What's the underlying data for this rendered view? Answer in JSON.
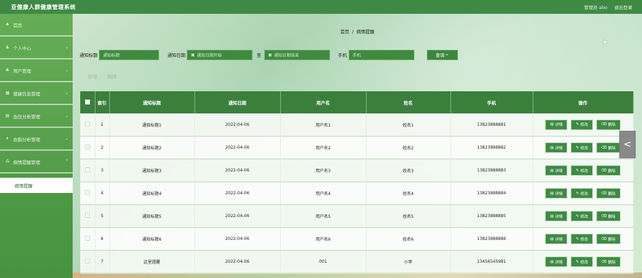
{
  "app": {
    "title": "亚健康人群健康管理系统"
  },
  "top": {
    "user": "管理员 abo",
    "logout": "退出登录"
  },
  "sidebar": {
    "items": [
      {
        "icon": "home-icon",
        "glyph": "♠",
        "label": "首页"
      },
      {
        "icon": "user-icon",
        "glyph": "♟",
        "label": "个人中心",
        "chev": "⌄"
      },
      {
        "icon": "users-icon",
        "glyph": "♣",
        "label": "用户管理",
        "chev": "⌄"
      },
      {
        "icon": "grid-icon",
        "glyph": "▦",
        "label": "健康信息管理",
        "chev": "⌄"
      },
      {
        "icon": "list-icon",
        "glyph": "▤",
        "label": "血压分析管理",
        "chev": "⌄"
      },
      {
        "icon": "pin-icon",
        "glyph": "✦",
        "label": "血脂分析管理",
        "chev": "⌄"
      },
      {
        "icon": "apps-icon",
        "glyph": "⁂",
        "label": "病情提醒管理",
        "chev": "⌃"
      }
    ],
    "sub_item": "病情提醒"
  },
  "breadcrumb": {
    "home": "首页",
    "sep": "/",
    "current": "病情提醒"
  },
  "search": {
    "title_label": "通知标题",
    "title_placeholder": "通知标题",
    "date_label": "通知日期",
    "date_start_placeholder": "通知日期开始",
    "to": "至",
    "date_end_placeholder": "通知日期结束",
    "phone_label": "手机",
    "phone_placeholder": "手机",
    "button": "查询"
  },
  "actions": {
    "add": "新增",
    "delete": "删除"
  },
  "table": {
    "columns": [
      "索引",
      "通知标题",
      "通知日期",
      "用户名",
      "姓名",
      "手机",
      "操作"
    ],
    "rows": [
      {
        "idx": "1",
        "title": "通知标题1",
        "date": "2022-04-06",
        "username": "用户名1",
        "name": "姓名1",
        "phone": "13823888881"
      },
      {
        "idx": "2",
        "title": "通知标题2",
        "date": "2022-04-06",
        "username": "用户名2",
        "name": "姓名2",
        "phone": "13823888882"
      },
      {
        "idx": "3",
        "title": "通知标题3",
        "date": "2022-04-06",
        "username": "用户名3",
        "name": "姓名3",
        "phone": "13823888883"
      },
      {
        "idx": "4",
        "title": "通知标题4",
        "date": "2022-04-06",
        "username": "用户名4",
        "name": "姓名4",
        "phone": "13823888884"
      },
      {
        "idx": "5",
        "title": "通知标题5",
        "date": "2022-04-06",
        "username": "用户名5",
        "name": "姓名5",
        "phone": "13823888885"
      },
      {
        "idx": "6",
        "title": "通知标题6",
        "date": "2022-04-06",
        "username": "用户名6",
        "name": "姓名6",
        "phone": "13823888886"
      },
      {
        "idx": "7",
        "title": "这里提醒",
        "date": "2022-04-06",
        "username": "001",
        "name": "小李",
        "phone": "13456545981"
      }
    ],
    "ops": {
      "detail": "详情",
      "edit": "修改",
      "delete": "删除"
    }
  },
  "side_tab": "<"
}
